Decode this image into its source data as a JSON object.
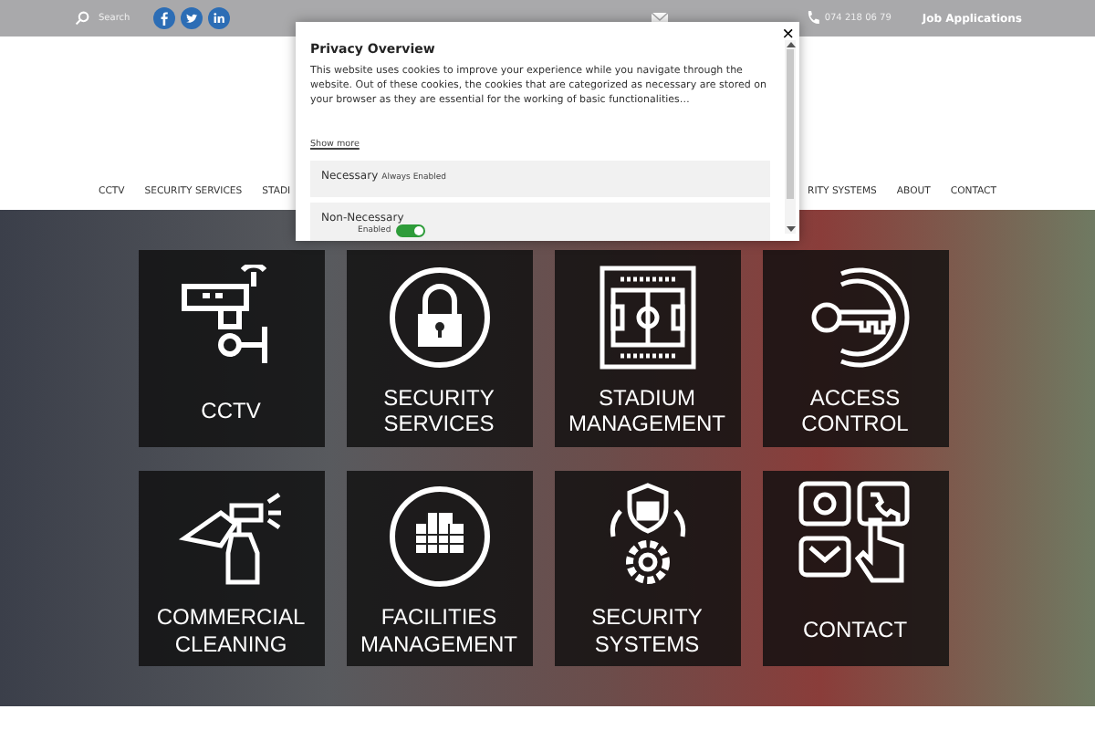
{
  "top_bar": {
    "search_label": "Search",
    "social": [
      {
        "kind": "facebook"
      },
      {
        "kind": "twitter"
      },
      {
        "kind": "linkedin"
      }
    ],
    "phone": "074 218 06 79",
    "job_link": "Job Applications"
  },
  "nav": {
    "left": [
      "CCTV",
      "SECURITY SERVICES",
      "STADI"
    ],
    "right": [
      "RITY SYSTEMS",
      "ABOUT",
      "CONTACT"
    ]
  },
  "privacy_modal": {
    "close": "×",
    "title": "Privacy Overview",
    "body": "This website uses cookies to improve your experience while you navigate through the website. Out of these cookies, the cookies that are categorized as necessary are stored on your browser as they are essential for the working of basic functionalities…",
    "show_more": "Show more",
    "categories": [
      {
        "name": "Necessary",
        "kind": "always",
        "status": "Always Enabled"
      },
      {
        "name": "Non-Necessary",
        "kind": "toggle",
        "status": "Enabled",
        "on": true
      }
    ]
  },
  "tiles": [
    {
      "kind": "cctv",
      "lines": [
        "CCTV"
      ]
    },
    {
      "kind": "lock",
      "lines": [
        "SECURITY",
        "SERVICES"
      ]
    },
    {
      "kind": "stadium",
      "lines": [
        "STADIUM",
        "MANAGEMENT"
      ]
    },
    {
      "kind": "key",
      "lines": [
        "ACCESS",
        "CONTROL"
      ]
    },
    {
      "kind": "spray",
      "lines": [
        "COMMERCIAL",
        "CLEANING"
      ]
    },
    {
      "kind": "building",
      "lines": [
        "FACILITIES",
        "MANAGEMENT"
      ]
    },
    {
      "kind": "shield",
      "lines": [
        "SECURITY",
        "SYSTEMS"
      ]
    },
    {
      "kind": "contact",
      "lines": [
        "CONTACT"
      ]
    }
  ]
}
